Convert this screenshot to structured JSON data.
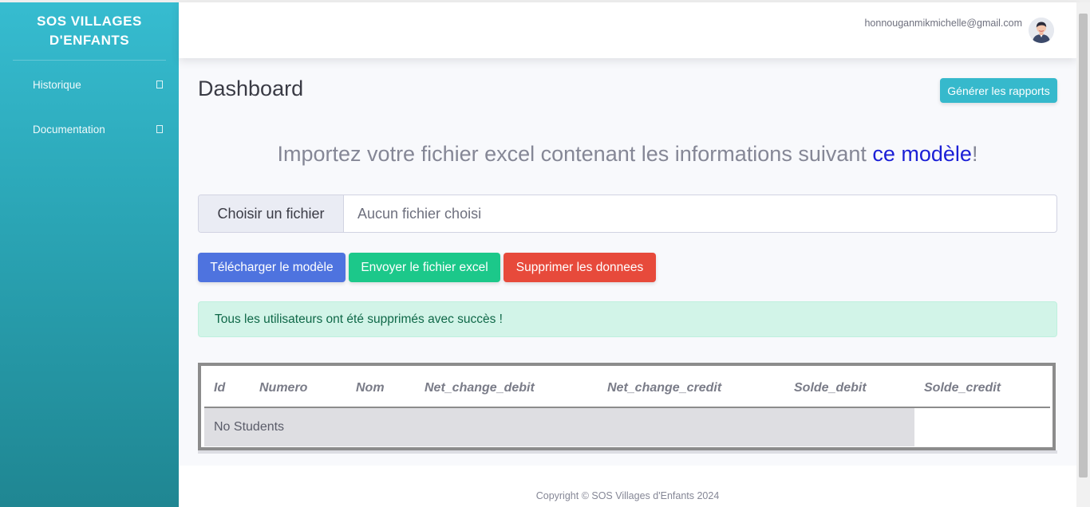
{
  "sidebar": {
    "brand_line1": "SOS VILLAGES",
    "brand_line2": "D'ENFANTS",
    "items": [
      {
        "label": "Historique"
      },
      {
        "label": "Documentation"
      }
    ]
  },
  "topbar": {
    "user_email": "honnouganmikmichelle@gmail.com"
  },
  "main": {
    "title": "Dashboard",
    "report_button": "Générer les rapports",
    "headline_text": "Importez votre fichier excel contenant les informations suivant ",
    "headline_link": "ce modèle",
    "headline_end": "!",
    "file_button": "Choisir un fichier",
    "file_status": "Aucun fichier choisi",
    "buttons": {
      "download": "Télécharger le modèle",
      "send": "Envoyer le fichier excel",
      "delete": "Supprimer les donnees"
    },
    "alert": "Tous les utilisateurs ont été supprimés avec succès !",
    "table": {
      "columns": [
        "Id",
        "Numero",
        "Nom",
        "Net_change_debit",
        "Net_change_credit",
        "Solde_debit",
        "Solde_credit"
      ],
      "empty_message": "No Students"
    }
  },
  "footer": {
    "copyright": "Copyright © SOS Villages d'Enfants 2024"
  },
  "colors": {
    "sidebar_top": "#36bcd0",
    "sidebar_bottom": "#1f8692",
    "primary": "#4e73df",
    "success": "#1cc88a",
    "danger": "#e74a3b",
    "info": "#36b9cc",
    "link": "#1b1fd6"
  }
}
